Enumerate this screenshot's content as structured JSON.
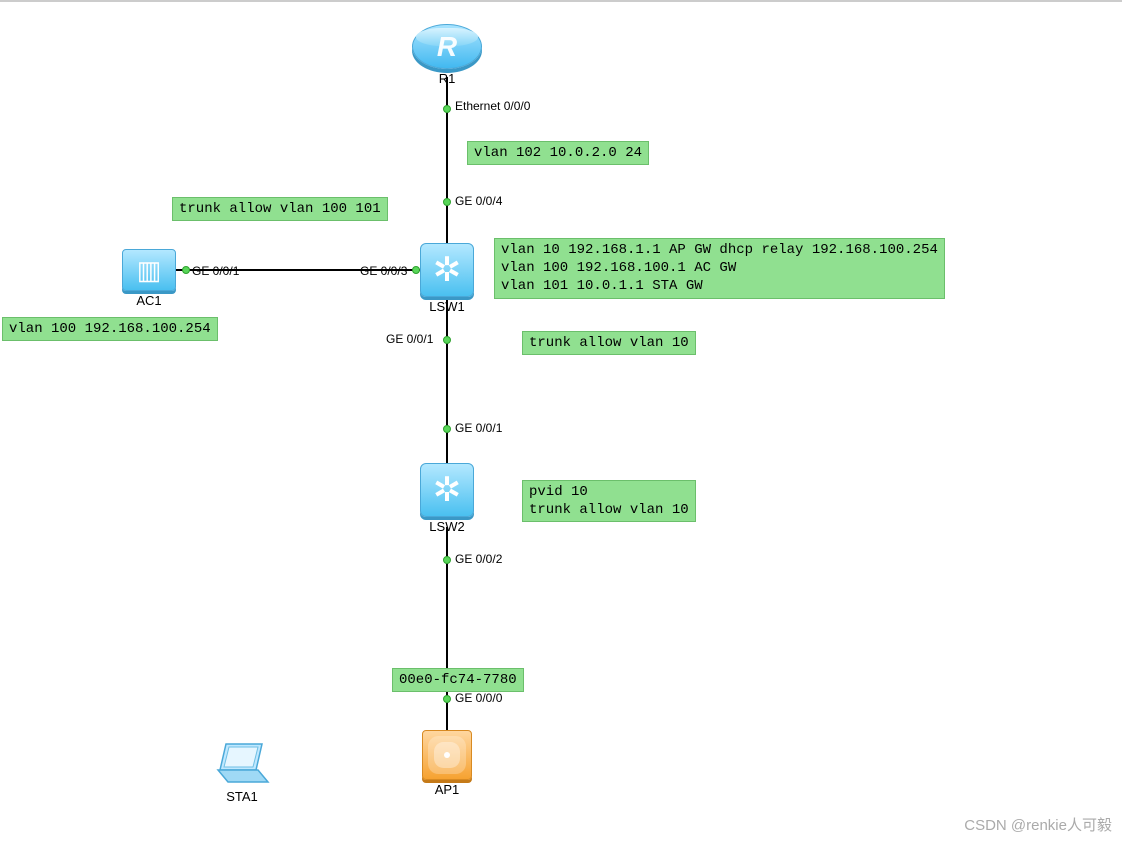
{
  "watermark": "CSDN @renkie人可毅",
  "devices": {
    "r1": {
      "label": "R1",
      "type": "router"
    },
    "lsw1": {
      "label": "LSW1",
      "type": "switch"
    },
    "lsw2": {
      "label": "LSW2",
      "type": "switch"
    },
    "ac1": {
      "label": "AC1",
      "type": "access-controller"
    },
    "ap1": {
      "label": "AP1",
      "type": "access-point"
    },
    "sta1": {
      "label": "STA1",
      "type": "station-laptop"
    }
  },
  "ports": {
    "r1_e000": "Ethernet 0/0/0",
    "lsw1_g004": "GE 0/0/4",
    "lsw1_g003": "GE 0/0/3",
    "lsw1_g001": "GE 0/0/1",
    "ac1_g001": "GE 0/0/1",
    "lsw2_g001": "GE 0/0/1",
    "lsw2_g002": "GE 0/0/2",
    "ap1_g000": "GE 0/0/0"
  },
  "notes": {
    "r1_net": "vlan 102 10.0.2.0 24",
    "ac_trunk": "trunk allow vlan 100 101",
    "lsw1_vlans": "vlan 10 192.168.1.1 AP GW dhcp relay 192.168.100.254\nvlan 100 192.168.100.1 AC GW\nvlan 101 10.0.1.1 STA GW",
    "ac1_ip": "vlan 100 192.168.100.254",
    "lsw1_down": "trunk allow vlan 10",
    "lsw2_cfg": "pvid 10\ntrunk allow vlan 10",
    "ap1_mac": "00e0-fc74-7780"
  },
  "links": [
    {
      "from": "R1",
      "from_port": "Ethernet 0/0/0",
      "to": "LSW1",
      "to_port": "GE 0/0/4"
    },
    {
      "from": "AC1",
      "from_port": "GE 0/0/1",
      "to": "LSW1",
      "to_port": "GE 0/0/3"
    },
    {
      "from": "LSW1",
      "from_port": "GE 0/0/1",
      "to": "LSW2",
      "to_port": "GE 0/0/1"
    },
    {
      "from": "LSW2",
      "from_port": "GE 0/0/2",
      "to": "AP1",
      "to_port": "GE 0/0/0"
    }
  ],
  "colors": {
    "note_bg": "#90e090",
    "device_blue": "#4ac0f0",
    "device_orange": "#f6a231",
    "link_dot": "#59d659"
  }
}
